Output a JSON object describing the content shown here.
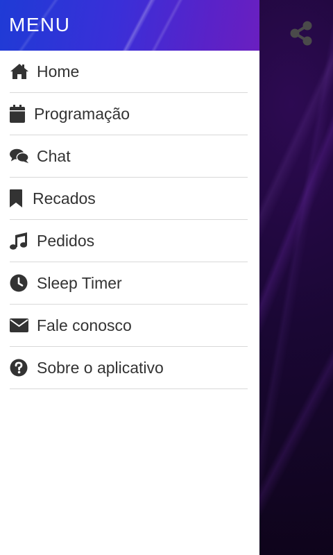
{
  "drawer": {
    "title": "MENU",
    "items": [
      {
        "label": "Home",
        "icon": "home-icon"
      },
      {
        "label": "Programação",
        "icon": "calendar-icon"
      },
      {
        "label": "Chat",
        "icon": "chat-icon"
      },
      {
        "label": "Recados",
        "icon": "bookmark-icon"
      },
      {
        "label": "Pedidos",
        "icon": "music-note-icon"
      },
      {
        "label": "Sleep Timer",
        "icon": "clock-icon"
      },
      {
        "label": "Fale conosco",
        "icon": "envelope-icon"
      },
      {
        "label": "Sobre o aplicativo",
        "icon": "question-circle-icon"
      }
    ]
  },
  "app": {
    "share_icon": "share-icon"
  },
  "colors": {
    "header_start": "#1f3bd6",
    "header_end": "#6a1fc0",
    "icon": "#333333",
    "text": "#333333",
    "divider": "#d8d8d8",
    "background": "#120620"
  }
}
